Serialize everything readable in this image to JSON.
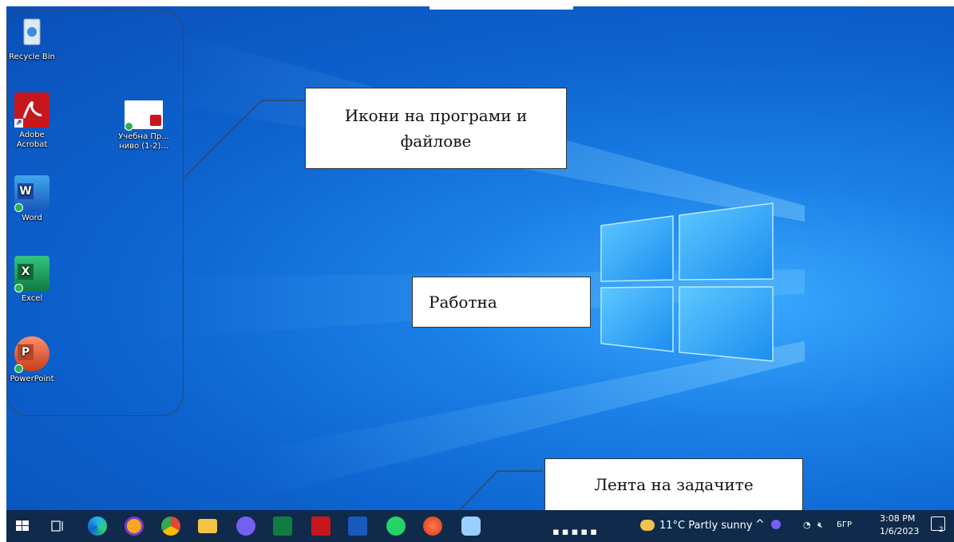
{
  "desktop_icons": {
    "recycle_bin": "Recycle Bin",
    "adobe": "Adobe\nAcrobat",
    "doc_file": "Учебна Пр...\nниво (1-2)...",
    "word": "Word",
    "excel": "Excel",
    "powerpoint": "PowerPoint"
  },
  "callouts": {
    "icons_label": "Икони на програми и файлове",
    "desktop_label": "Работна",
    "taskbar_label": "Лента на задачите"
  },
  "tray": {
    "weather": "11°C  Partly sunny",
    "language": "БГР",
    "time": "3:08 PM",
    "date": "1/6/2023",
    "notifications": "2"
  },
  "colors": {
    "desktop_blue": "#0d63cf",
    "taskbar": "#0f2a4a"
  }
}
